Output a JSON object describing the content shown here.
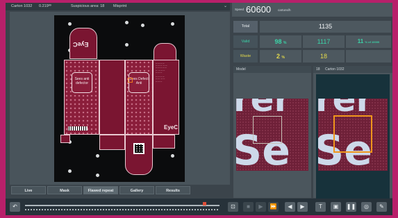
{
  "topbar": {
    "carton": "Carton 1032",
    "size": "0.219ºº",
    "suspicious": "Suspicious area: 18",
    "defect_type": "Misprint",
    "chevron_icon": "chevron-down-icon"
  },
  "viewer": {
    "tabs": [
      {
        "label": "Live",
        "active": false
      },
      {
        "label": "Mask",
        "active": false
      },
      {
        "label": "Flawed repeat",
        "active": true
      },
      {
        "label": "Gallery",
        "active": false
      },
      {
        "label": "Results",
        "active": false
      }
    ],
    "carton_art": {
      "front_text_1": "Sees anti",
      "front_text_2": "defector",
      "side_text_1": "Sees Defect",
      "side_text_2": "Anti",
      "logo": "EyeC",
      "flipped_logo": "EyeC"
    }
  },
  "stats": {
    "speed_label": "Speed",
    "speed_value": "60600",
    "speed_unit": "cartons/h",
    "total_label": "Total",
    "total_value": "1135",
    "valid_label": "Valid",
    "valid_percent": "98",
    "valid_count": "1117",
    "valid_ref": "11",
    "valid_ref_unit": "% of 10000",
    "waste_label": "Waste",
    "waste_percent": "2",
    "waste_count": "18",
    "percent_sign": "%",
    "valid_color": "#3bd4a8",
    "waste_color": "#e3d94c"
  },
  "model_panel": {
    "title": "Model",
    "crop_text_top": "rer",
    "crop_text_bottom": "Se"
  },
  "sample_panel": {
    "index": "18",
    "title": "Carton 1032",
    "crop_text_top": "rer",
    "crop_text_bottom": "Se",
    "box_color": "#f0961b"
  },
  "toolbar": {
    "buttons": [
      "undo-icon",
      "fit-view-icon",
      "stop-icon",
      "play-icon",
      "fast-forward-icon",
      "prev-icon",
      "next-icon",
      "text-icon",
      "image-icon",
      "pause-icon",
      "camera-icon",
      "clipboard-icon"
    ],
    "marker_color": "#e0503a"
  }
}
